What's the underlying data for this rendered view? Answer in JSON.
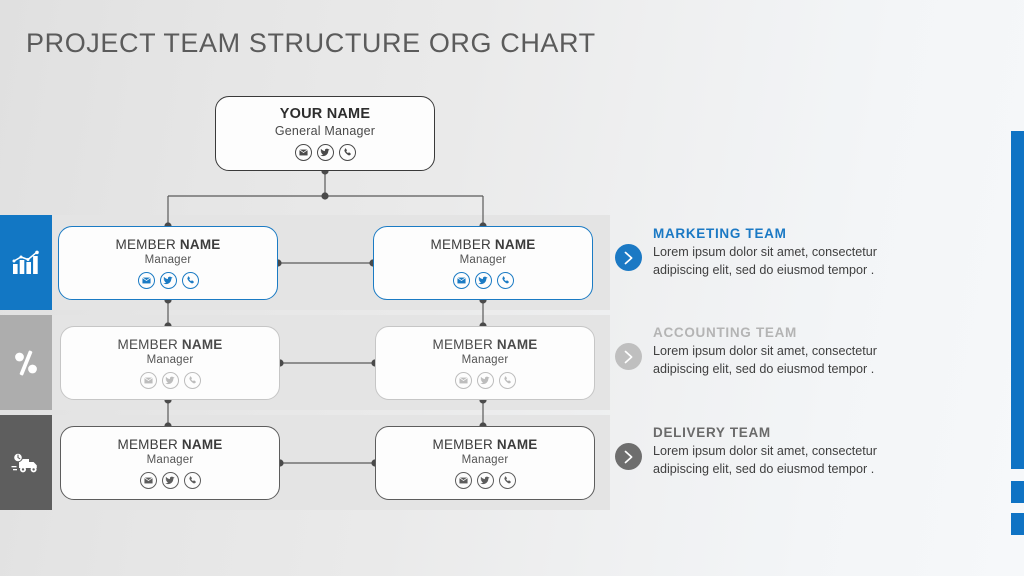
{
  "slide": {
    "title": "PROJECT TEAM STRUCTURE ORG CHART"
  },
  "colors": {
    "accent_blue": "#1277c4",
    "mid_gray": "#adadad",
    "dark_gray": "#5e5e5e",
    "background_left": "#e0e0e0",
    "background_right": "#f6f8fa"
  },
  "sidebar": {
    "items": [
      {
        "icon": "growth-bar-chart-icon",
        "color": "#1277c4"
      },
      {
        "icon": "percent-icon",
        "color": "#adadad"
      },
      {
        "icon": "delivery-truck-icon",
        "color": "#5e5e5e"
      }
    ]
  },
  "org_chart": {
    "root": {
      "name": "YOUR NAME",
      "role": "General Manager",
      "icons": [
        "email-icon",
        "twitter-icon",
        "phone-icon"
      ]
    },
    "rows": [
      {
        "style": "blue",
        "nodes": [
          {
            "name_regular": "MEMBER ",
            "name_bold": "NAME",
            "role": "Manager",
            "icons": [
              "email-icon",
              "twitter-icon",
              "phone-icon"
            ]
          },
          {
            "name_regular": "MEMBER ",
            "name_bold": "NAME",
            "role": "Manager",
            "icons": [
              "email-icon",
              "twitter-icon",
              "phone-icon"
            ]
          }
        ]
      },
      {
        "style": "light-gray",
        "nodes": [
          {
            "name_regular": "MEMBER ",
            "name_bold": "NAME",
            "role": "Manager",
            "icons": [
              "email-icon",
              "twitter-icon",
              "phone-icon"
            ]
          },
          {
            "name_regular": "MEMBER ",
            "name_bold": "NAME",
            "role": "Manager",
            "icons": [
              "email-icon",
              "twitter-icon",
              "phone-icon"
            ]
          }
        ]
      },
      {
        "style": "dark-gray",
        "nodes": [
          {
            "name_regular": "MEMBER ",
            "name_bold": "NAME",
            "role": "Manager",
            "icons": [
              "email-icon",
              "twitter-icon",
              "phone-icon"
            ]
          },
          {
            "name_regular": "MEMBER ",
            "name_bold": "NAME",
            "role": "Manager",
            "icons": [
              "email-icon",
              "twitter-icon",
              "phone-icon"
            ]
          }
        ]
      }
    ]
  },
  "teams": [
    {
      "heading": "MARKETING TEAM",
      "body": "Lorem ipsum dolor sit amet, consectetur adipiscing elit, sed do eiusmod tempor .",
      "arrow_color": "#1b79c4",
      "heading_color": "#1b79c4"
    },
    {
      "heading": "ACCOUNTING TEAM",
      "body": "Lorem ipsum dolor sit amet, consectetur adipiscing elit, sed do eiusmod tempor .",
      "arrow_color": "#bfbfbf",
      "heading_color": "#b4b4b4"
    },
    {
      "heading": "DELIVERY TEAM",
      "body": "Lorem ipsum dolor sit amet, consectetur adipiscing elit, sed do eiusmod tempor .",
      "arrow_color": "#6e6e6e",
      "heading_color": "#6a6a6a"
    }
  ]
}
